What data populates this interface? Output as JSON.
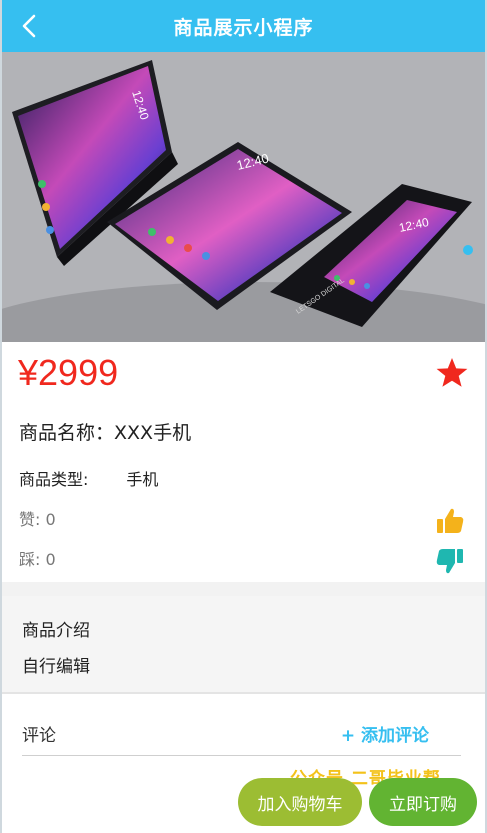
{
  "navbar": {
    "title": "商品展示小程序"
  },
  "hero": {
    "phone_time_1": "12:40",
    "phone_time_2": "12:40",
    "phone_time_3": "12:40",
    "brand_text": "LETSGO DIGITAL"
  },
  "product": {
    "price": "¥2999",
    "name_label": "商品名称：",
    "name_value": "XXX手机",
    "type_label": "商品类型:",
    "type_value": "手机",
    "like_label": "赞:",
    "like_count": "0",
    "dislike_label": "踩:",
    "dislike_count": "0"
  },
  "intro": {
    "title": "商品介绍",
    "content": "自行编辑"
  },
  "comments": {
    "label": "评论",
    "add_label": "+ 添加评论"
  },
  "watermark": "公众号 二哥毕业帮",
  "actions": {
    "add_to_cart": "加入购物车",
    "buy_now": "立即订购"
  },
  "colors": {
    "accent": "#36bff0",
    "price": "#f0281e",
    "cart_button": "#9cbd33",
    "buy_button": "#62b432",
    "like_icon": "#f4b21b",
    "dislike_icon": "#1fb7b0"
  }
}
